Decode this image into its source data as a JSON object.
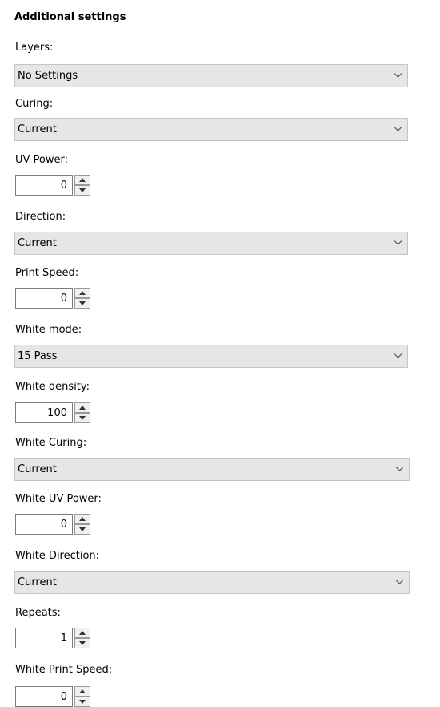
{
  "section_title": "Additional settings",
  "dropdown_arrow_icon": "chevron-down-icon",
  "spinner_icons": [
    "spin-up-icon",
    "spin-down-icon"
  ],
  "fields": {
    "layers": {
      "label": "Layers:",
      "value": "No Settings"
    },
    "curing": {
      "label": "Curing:",
      "value": "Current"
    },
    "uv_power": {
      "label": "UV Power:",
      "value": "0"
    },
    "direction": {
      "label": "Direction:",
      "value": "Current"
    },
    "print_speed": {
      "label": "Print Speed:",
      "value": "0"
    },
    "white_mode": {
      "label": "White mode:",
      "value": "15 Pass"
    },
    "white_density": {
      "label": "White density:",
      "value": "100"
    },
    "white_curing": {
      "label": "White Curing:",
      "value": "Current"
    },
    "white_uv_power": {
      "label": "White UV Power:",
      "value": "0"
    },
    "white_direction": {
      "label": "White Direction:",
      "value": "Current"
    },
    "repeats": {
      "label": "Repeats:",
      "value": "1"
    },
    "white_print_speed": {
      "label": "White Print Speed:",
      "value": "0"
    }
  }
}
